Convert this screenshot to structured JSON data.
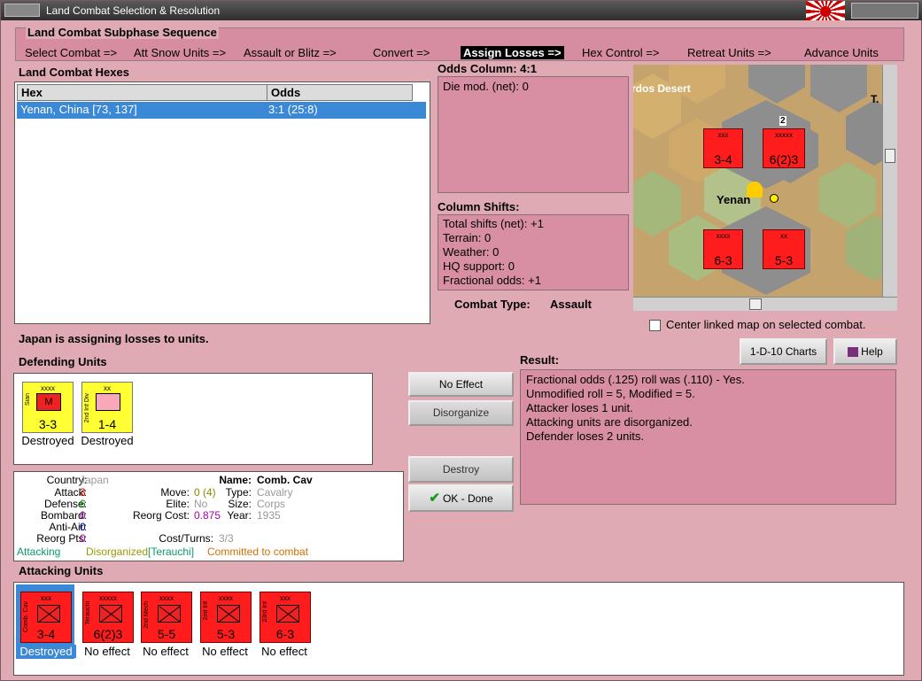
{
  "window": {
    "title": "Land Combat Selection & Resolution"
  },
  "sequence": {
    "label": "Land Combat Subphase Sequence",
    "steps": [
      "Select Combat =>",
      "Att Snow Units =>",
      "Assault or Blitz =>",
      "Convert =>",
      "Assign Losses =>",
      "Hex Control =>",
      "Retreat Units =>",
      "Advance Units"
    ],
    "active_index": 4
  },
  "hexes": {
    "label": "Land Combat Hexes",
    "columns": [
      "Hex",
      "Odds"
    ],
    "rows": [
      {
        "hex": "Yenan, China [73, 137]",
        "odds": "3:1 (25:8)"
      }
    ]
  },
  "odds": {
    "label": "Odds Column: 4:1",
    "die_mod": "Die mod. (net): 0"
  },
  "shifts": {
    "label": "Column Shifts:",
    "lines": [
      "Total shifts (net): +1",
      "Terrain: 0",
      "Weather: 0",
      "HQ support: 0",
      "Fractional odds: +1"
    ]
  },
  "combat_type": {
    "label": "Combat Type:",
    "value": "Assault"
  },
  "map": {
    "desert_label": "rdos Desert",
    "city_label": "Yenan",
    "stack_count": "2",
    "partial_label": "T.",
    "center_option": "Center linked map on selected combat."
  },
  "status_message": "Japan is assigning losses to units.",
  "buttons": {
    "charts": "1-D-10 Charts",
    "help": "Help",
    "no_effect": "No Effect",
    "disorganize": "Disorganize",
    "destroy": "Destroy",
    "ok_done": "OK - Done"
  },
  "result": {
    "label": "Result:",
    "lines": [
      "Fractional odds (.125) roll was (.110)  - Yes.",
      "Unmodified roll = 5, Modified = 5.",
      "Attacker loses 1 unit.",
      "Attacking units are disorganized.",
      "Defender loses 2 units."
    ]
  },
  "defending": {
    "label": "Defending Units",
    "units": [
      {
        "size": "xxxx",
        "side": "Sian",
        "symbol": "M",
        "value": "3-3",
        "status": "Destroyed"
      },
      {
        "size": "xx",
        "side": "2nd Inf Div",
        "symbol": "",
        "value": "1-4",
        "status": "Destroyed"
      }
    ]
  },
  "details": {
    "country_label": "Country:",
    "country": "Japan",
    "attack_label": "Attack:",
    "attack": "3",
    "defense_label": "Defense:",
    "defense": "6",
    "bombard_label": "Bombard:",
    "bombard": "0",
    "antiair_label": "Anti-Air:",
    "antiair": "0",
    "reorg_pts_label": "Reorg Pts:",
    "reorg_pts": "0",
    "move_label": "Move:",
    "move": "0 (4)",
    "elite_label": "Elite:",
    "elite": "No",
    "reorg_cost_label": "Reorg Cost:",
    "reorg_cost": "0.875",
    "cost_turns_label": "Cost/Turns:",
    "cost_turns": "3/3",
    "name_label": "Name:",
    "name": "Comb. Cav",
    "type_label": "Type:",
    "type": "Cavalry",
    "size_label": "Size:",
    "size": "Corps",
    "year_label": "Year:",
    "year": "1935",
    "flags": {
      "attacking": "Attacking",
      "disorganized": "Disorganized",
      "leader": "[Terauchi]",
      "committed": "Committed to combat"
    }
  },
  "attacking": {
    "label": "Attacking Units",
    "units": [
      {
        "size": "xxx",
        "side": "Comb. Cav",
        "value": "3-4",
        "status": "Destroyed"
      },
      {
        "size": "xxxxx",
        "side": "Terauchi",
        "value": "6(2)3",
        "status": "No effect"
      },
      {
        "size": "xxxx",
        "side": "2nd Mech",
        "value": "5-5",
        "status": "No effect"
      },
      {
        "size": "xxxx",
        "side": "2nd Inf",
        "value": "5-3",
        "status": "No effect"
      },
      {
        "size": "xxx",
        "side": "23rd Inf",
        "value": "6-3",
        "status": "No effect"
      }
    ]
  },
  "map_counters": [
    {
      "size": "xxx",
      "value": "3-4"
    },
    {
      "size": "xxxxx",
      "value": "6(2)3"
    },
    {
      "size": "xxxx",
      "value": "6-3"
    },
    {
      "size": "xx",
      "value": "5-3"
    }
  ],
  "colors": {
    "background": "#dfaab3",
    "panel_pink": "#d88ea3",
    "selection": "#3b88d6",
    "counter_red": "#ff1c1c",
    "counter_yellow": "#ffff33",
    "active_step": "#000000"
  }
}
